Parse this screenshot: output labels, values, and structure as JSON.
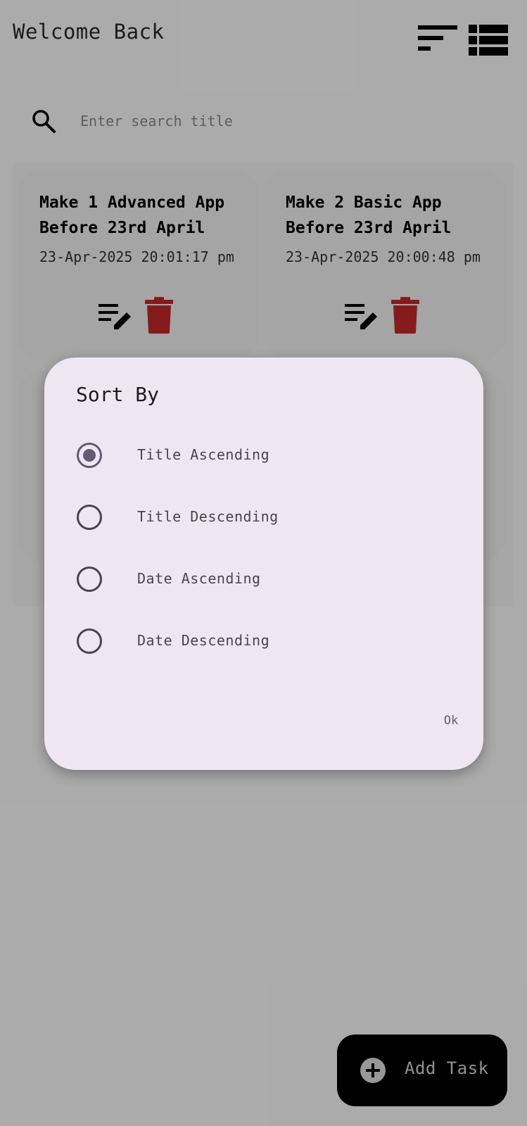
{
  "header": {
    "title": "Welcome Back"
  },
  "toolbar": {
    "sort_icon": "sort-icon",
    "view_icon": "view-list-icon"
  },
  "search": {
    "placeholder": "Enter search title",
    "value": ""
  },
  "tasks": [
    {
      "title": "Make 1 Advanced App Before 23rd April",
      "date": "23-Apr-2025 20:01:17 pm"
    },
    {
      "title": "Make 2 Basic App Before 23rd April",
      "date": "23-Apr-2025 20:00:48 pm"
    }
  ],
  "dialog": {
    "title": "Sort By",
    "options": [
      {
        "label": "Title Ascending",
        "selected": true
      },
      {
        "label": "Title Descending",
        "selected": false
      },
      {
        "label": "Date Ascending",
        "selected": false
      },
      {
        "label": "Date Descending",
        "selected": false
      }
    ],
    "ok_label": "Ok"
  },
  "fab": {
    "label": "Add Task"
  },
  "colors": {
    "delete": "#c62828",
    "dialog_bg": "#eee7f3",
    "radio_selected": "#625b71",
    "scrim": "rgba(0,0,0,0.32)"
  }
}
